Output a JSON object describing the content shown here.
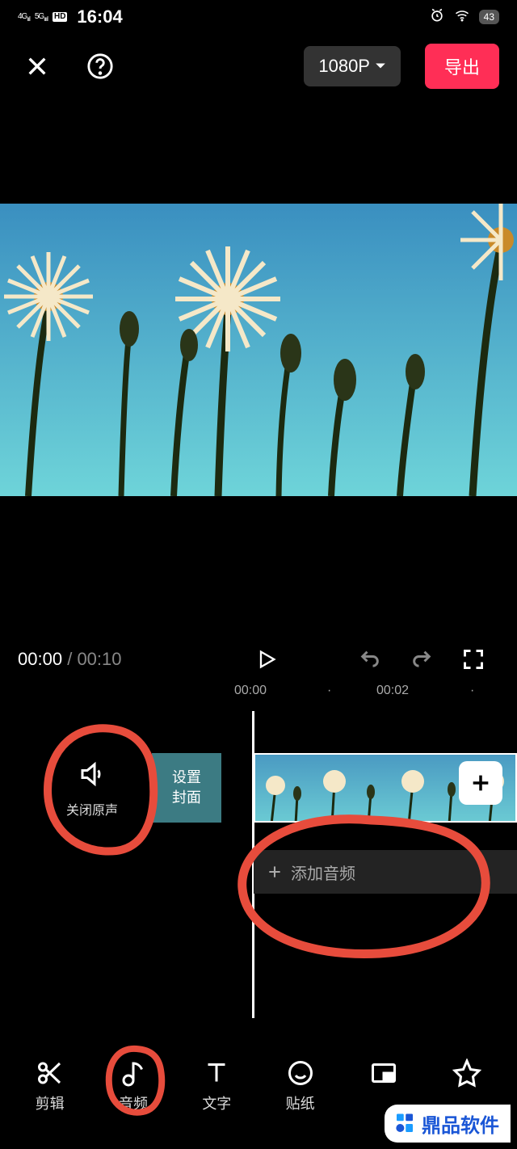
{
  "status": {
    "net1": "4G",
    "net2": "5G",
    "hd": "HD",
    "time": "16:04",
    "battery": "43"
  },
  "topbar": {
    "resolution": "1080P",
    "export": "导出"
  },
  "playback": {
    "current": "00:00",
    "separator": "/",
    "total": "00:10"
  },
  "ruler": {
    "t0": "00:00",
    "dot": "·",
    "t1": "00:02"
  },
  "tracks": {
    "mute_label": "关闭原声",
    "cover_line1": "设置",
    "cover_line2": "封面",
    "add_audio": "添加音频"
  },
  "tools": [
    {
      "id": "edit",
      "label": "剪辑"
    },
    {
      "id": "audio",
      "label": "音频"
    },
    {
      "id": "text",
      "label": "文字"
    },
    {
      "id": "sticker",
      "label": "贴纸"
    }
  ],
  "watermark": "鼎品软件"
}
